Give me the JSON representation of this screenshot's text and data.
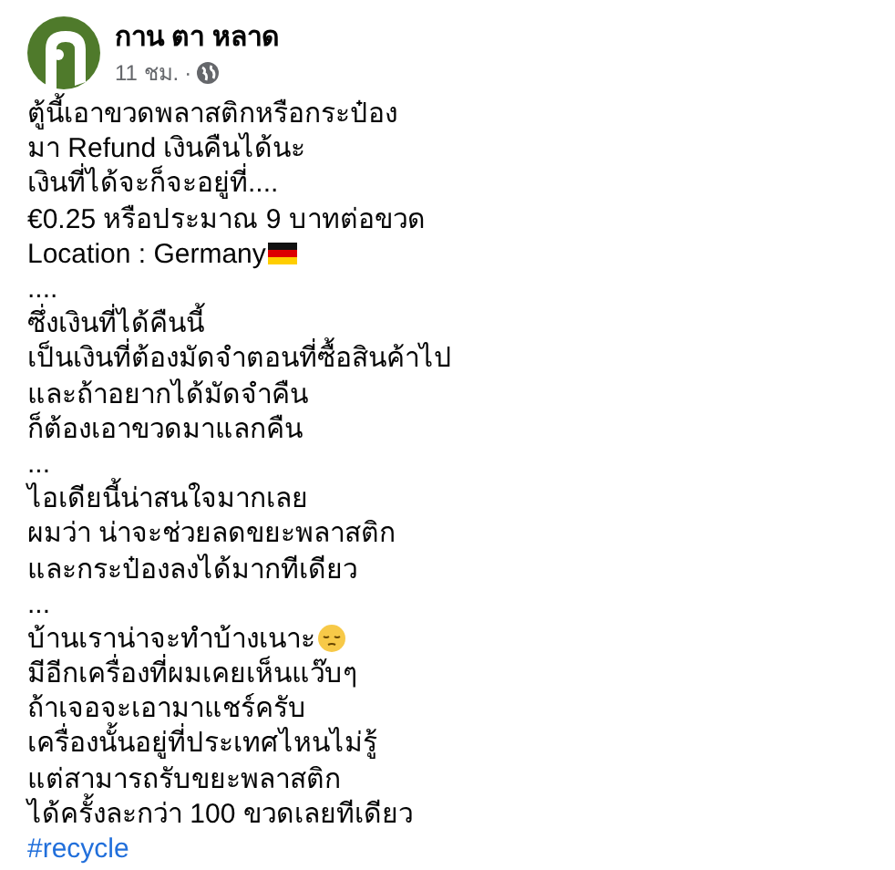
{
  "header": {
    "name": "กาน ตา หลาด",
    "time": "11 ชม.",
    "separator": "·"
  },
  "lines": [
    {
      "kind": "plain",
      "text": "ตู้นี้เอาขวดพลาสติกหรือกระป๋อง"
    },
    {
      "kind": "plain",
      "text": "มา Refund เงินคืนได้นะ"
    },
    {
      "kind": "plain",
      "text": "เงินที่ได้จะก็จะอยู่ที่...."
    },
    {
      "kind": "plain",
      "text": "€0.25 หรือประมาณ 9 บาทต่อขวด"
    },
    {
      "kind": "flag",
      "text": "Location : Germany"
    },
    {
      "kind": "plain",
      "text": "...."
    },
    {
      "kind": "plain",
      "text": "ซึ่งเงินที่ได้คืนนี้"
    },
    {
      "kind": "plain",
      "text": "เป็นเงินที่ต้องมัดจำตอนที่ซื้อสินค้าไป"
    },
    {
      "kind": "plain",
      "text": "และถ้าอยากได้มัดจำคืน"
    },
    {
      "kind": "plain",
      "text": "ก็ต้องเอาขวดมาแลกคืน"
    },
    {
      "kind": "plain",
      "text": "..."
    },
    {
      "kind": "plain",
      "text": "ไอเดียนี้น่าสนใจมากเลย"
    },
    {
      "kind": "plain",
      "text": "ผมว่า น่าจะช่วยลดขยะพลาสติก"
    },
    {
      "kind": "plain",
      "text": "และกระป๋องลงได้มากทีเดียว"
    },
    {
      "kind": "plain",
      "text": "..."
    },
    {
      "kind": "face",
      "text": "บ้านเราน่าจะทำบ้างเนาะ"
    },
    {
      "kind": "plain",
      "text": "มีอีกเครื่องที่ผมเคยเห็นแว๊บๆ"
    },
    {
      "kind": "plain",
      "text": "ถ้าเจอจะเอามาแชร์ครับ"
    },
    {
      "kind": "plain",
      "text": "เครื่องนั้นอยู่ที่ประเทศไหนไม่รู้"
    },
    {
      "kind": "plain",
      "text": "แต่สามารถรับขยะพลาสติก"
    },
    {
      "kind": "plain",
      "text": "ได้ครั้งละกว่า 100 ขวดเลยทีเดียว"
    },
    {
      "kind": "hashtag",
      "text": "#recycle"
    }
  ]
}
